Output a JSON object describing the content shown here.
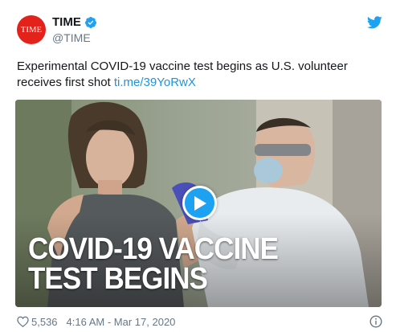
{
  "account": {
    "avatar_text": "TIME",
    "display_name": "TIME",
    "handle": "@TIME",
    "verified": true,
    "brand_color": "#e2221b"
  },
  "tweet": {
    "text": "Experimental COVID-19 vaccine test begins as U.S. volunteer receives first shot",
    "link": "ti.me/39YoRwX",
    "link_color": "#1b95e0"
  },
  "media": {
    "headline_line1": "COVID-19 VACCINE",
    "headline_line2": "TEST BEGINS",
    "play_icon": "play-icon",
    "accent": "#1da1f2"
  },
  "footer": {
    "like_count": "5,536",
    "timestamp": "4:16 AM - Mar 17, 2020"
  }
}
